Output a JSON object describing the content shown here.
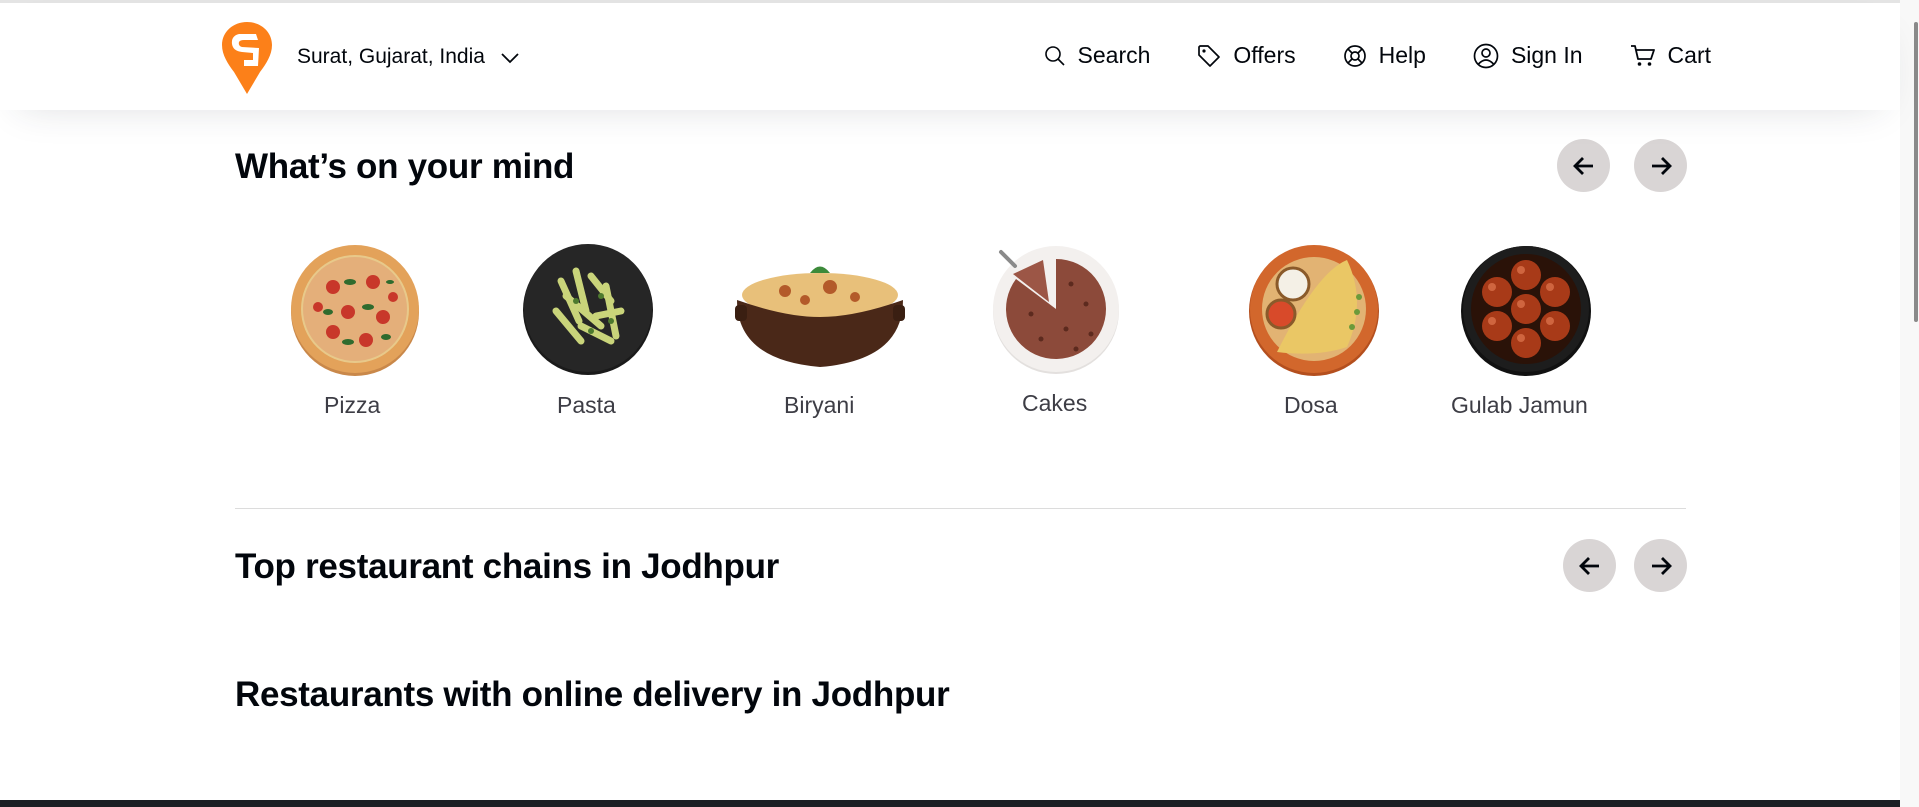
{
  "header": {
    "location": "Surat, Gujarat, India",
    "nav": [
      {
        "label": "Search",
        "icon": "search-icon"
      },
      {
        "label": "Offers",
        "icon": "offers-tag-icon"
      },
      {
        "label": "Help",
        "icon": "help-lifebuoy-icon"
      },
      {
        "label": "Sign In",
        "icon": "user-icon"
      },
      {
        "label": "Cart",
        "icon": "cart-icon"
      }
    ]
  },
  "mind": {
    "title": "What’s on your mind",
    "dishes": [
      "Pizza",
      "Pasta",
      "Biryani",
      "Cakes",
      "Dosa",
      "Gulab Jamun"
    ]
  },
  "chains": {
    "title": "Top restaurant chains in Jodhpur"
  },
  "delivery": {
    "title": "Restaurants with online delivery in Jodhpur"
  },
  "colors": {
    "brand": "#fc8019",
    "arrow_bg": "#d9d5d5",
    "text": "#02060c"
  }
}
